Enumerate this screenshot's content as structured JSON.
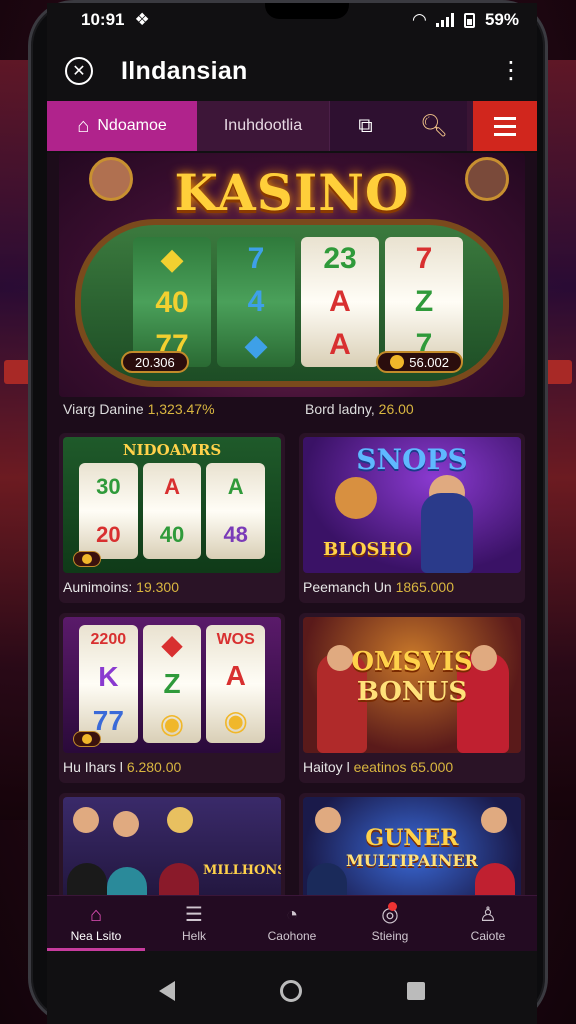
{
  "status": {
    "time": "10:91",
    "battery": "59%"
  },
  "appbar": {
    "title": "Ilndansian"
  },
  "tabs": {
    "home": "Ndoamoe",
    "second": "Inuhdootlia"
  },
  "hero": {
    "title": "KASINO",
    "badge_left": "20.306",
    "badge_right": "56.002",
    "label_left": {
      "name": "Viarg Danine",
      "amount": "1,323.47%"
    },
    "label_right": {
      "name": "Bord ladny,",
      "amount": "26.00"
    }
  },
  "cards": [
    {
      "title": "NIDOAMRS",
      "name": "Aunimoins:",
      "amount": "19.300"
    },
    {
      "title": "SNOPS",
      "sub": "BLOSHO",
      "name": "Peemanch Un",
      "amount": "1865.000"
    },
    {
      "title": "",
      "name": "Hu Ihars l",
      "amount": "6.280.00"
    },
    {
      "title": "OMSVIS",
      "sub": "BONUS",
      "name": "Haitoy l",
      "amount": "eeatinos 65.000"
    },
    {
      "title": "MILLHONS",
      "name": "",
      "amount": ""
    },
    {
      "title": "GUNER",
      "sub": "MULTIPAINER",
      "name": "",
      "amount": ""
    }
  ],
  "nav": [
    {
      "label": "Nea Lsito",
      "icon": "home-icon"
    },
    {
      "label": "Helk",
      "icon": "list-icon"
    },
    {
      "label": "Caohone",
      "icon": "gauge-icon"
    },
    {
      "label": "Stieing",
      "icon": "bell-icon"
    },
    {
      "label": "Caiote",
      "icon": "user-icon"
    }
  ]
}
